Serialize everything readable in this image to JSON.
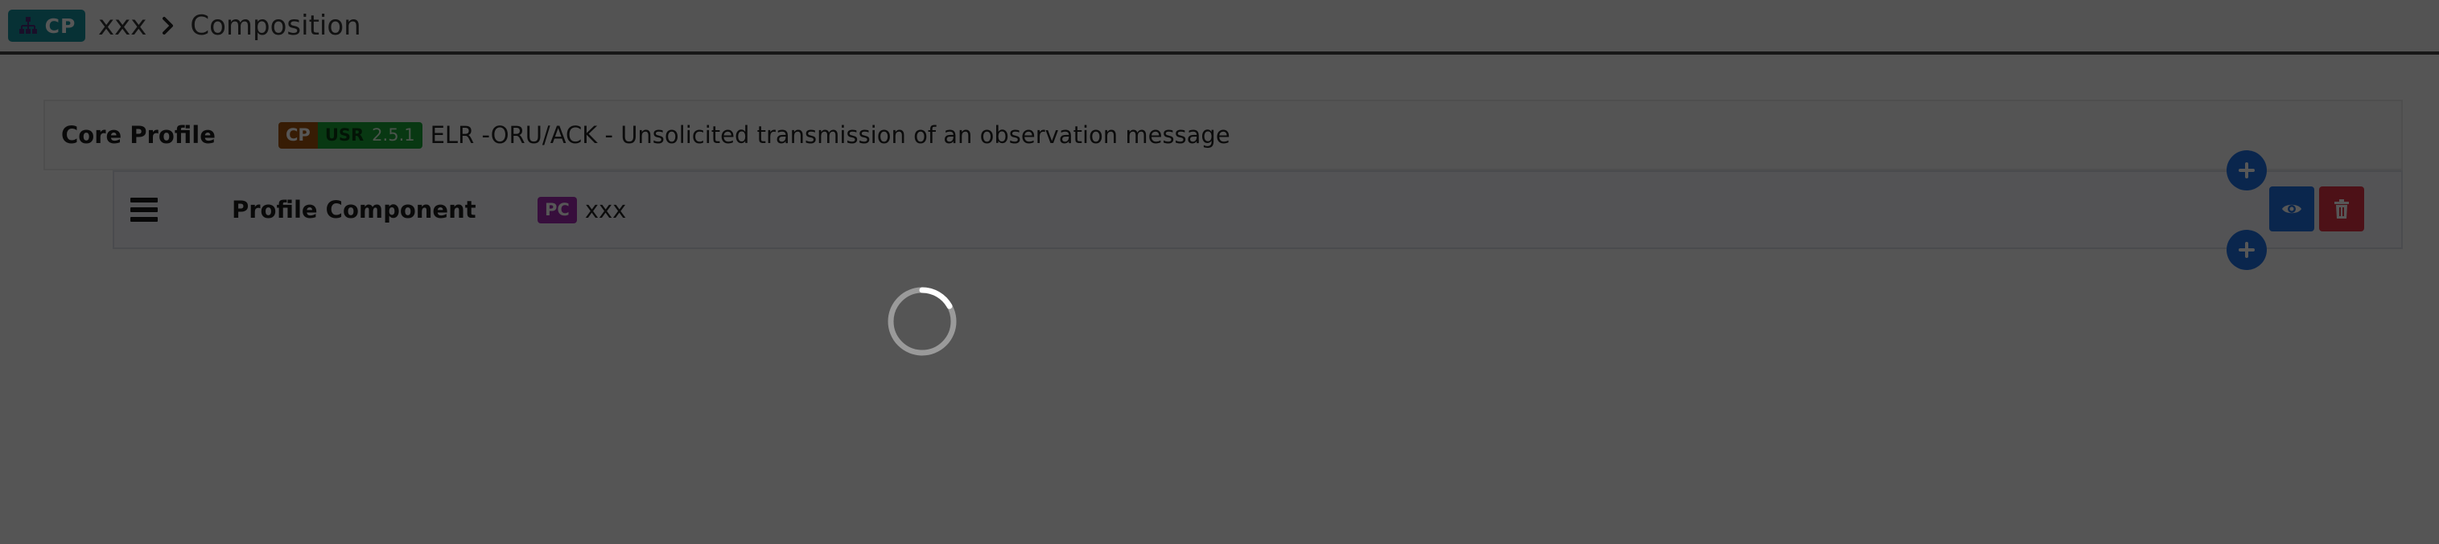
{
  "header": {
    "chip_icon": "sitemap-icon",
    "chip_label": "CP",
    "project_name": "xxx",
    "separator_icon": "chevron-right-icon",
    "page_title": "Composition"
  },
  "core_profile": {
    "label": "Core Profile",
    "badge_type": "CP",
    "badge_scope": "USR",
    "badge_version": "2.5.1",
    "title": "ELR -ORU/ACK - Unsolicited transmission of an observation message"
  },
  "profile_component": {
    "handle_icon": "bars-icon",
    "label": "Profile Component",
    "badge_type": "PC",
    "name": "xxx",
    "view_icon": "eye-icon",
    "delete_icon": "trash-icon"
  },
  "add_buttons": {
    "icon": "plus-icon"
  },
  "loading": {
    "icon": "spinner-icon"
  },
  "colors": {
    "chip_bg": "#15919d",
    "badge_cp": "#a0540c",
    "badge_usr": "#1aa536",
    "badge_pc": "#a12bb0",
    "primary": "#1f6fe2",
    "danger": "#e23344",
    "overlay": "rgba(0,0,0,0.66)"
  }
}
